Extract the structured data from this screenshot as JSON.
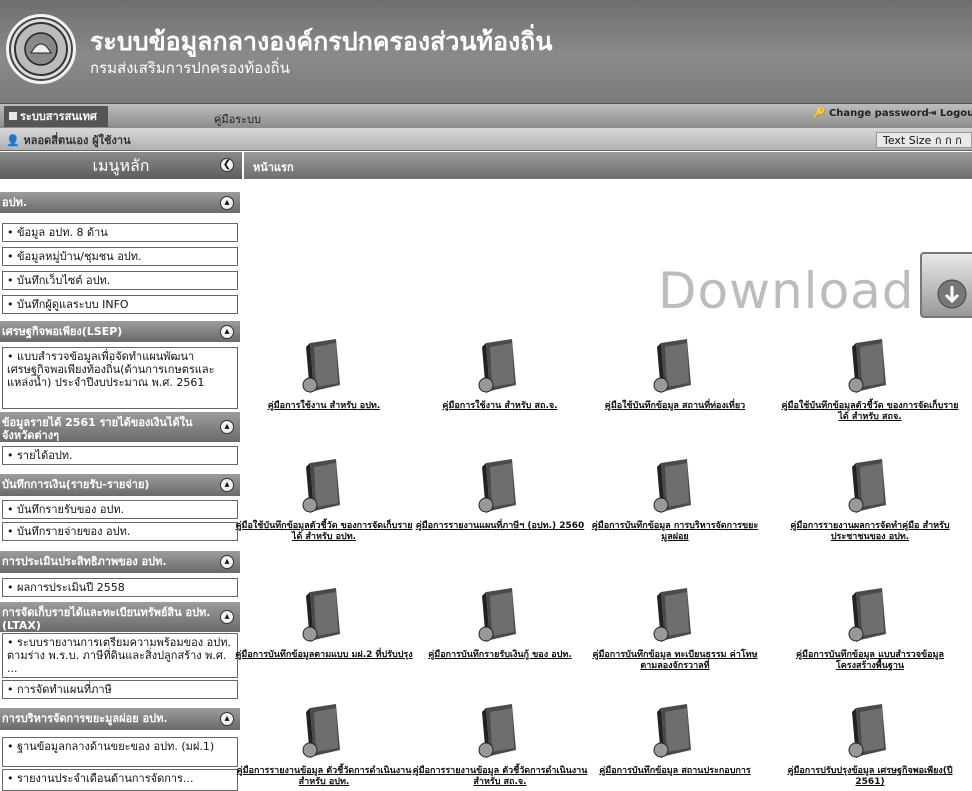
{
  "header": {
    "title": "ระบบข้อมูลกลางองค์กรปกครองส่วนท้องถิ่น",
    "subtitle": "กรมส่งเสริมการปกครองท้องถิ่น",
    "logo_icon": "government-seal"
  },
  "menubar": {
    "home_tab": "ระบบสารสนเทศ",
    "manual_tab": "คู่มือระบบ",
    "change_password": "Change password",
    "logout": "Logout"
  },
  "userbar": {
    "user_label": "หลอดสี่ตนเอง ผู้ใช้งาน",
    "text_size": "Text Size  ก ก ก"
  },
  "sidebar": {
    "title": "เมนูหลัก",
    "breadcrumb": "หน้าแรก",
    "sections": [
      {
        "title": "อปท.",
        "items": [
          "ข้อมูล อปท. 8 ด้าน",
          "ข้อมูลหมู่บ้าน/ชุมชน อปท.",
          "บันทึกเว็บไซต์ อปท.",
          "บันทึกผู้ดูแลระบบ INFO"
        ]
      },
      {
        "title": "เศรษฐกิจพอเพียง(LSEP)",
        "items": [
          "แบบสำรวจข้อมูลเพื่อจัดทำแผนพัฒนาเศรษฐกิจพอเพียงท้องถิ่น(ด้านการเกษตรและแหล่งน้ำ) ประจำปีงบประมาณ พ.ศ. 2561"
        ]
      },
      {
        "title": "ข้อมูลรายได้ 2561 รายได้ของเงินได้ในจังหวัดต่างๆ",
        "items": [
          "รายได้อปท."
        ]
      },
      {
        "title": "บันทึกการเงิน(รายรับ-รายจ่าย)",
        "items": [
          "บันทึกรายรับของ อปท.",
          "บันทึกรายจ่ายของ อปท."
        ]
      },
      {
        "title": "การประเมินประสิทธิภาพของ อปท.",
        "items": [
          "ผลการประเมินปี 2558"
        ]
      },
      {
        "title": "การจัดเก็บรายได้และทะเบียนทรัพย์สิน อปท. (LTAX)",
        "items": [
          "ระบบรายงานการเตรียมความพร้อมของ อปท. ตามร่าง พ.ร.บ. ภาษีที่ดินและสิ่งปลูกสร้าง พ.ศ. ...",
          "การจัดทำแผนที่ภาษี"
        ]
      },
      {
        "title": "การบริหารจัดการขยะมูลฝอย อปท.",
        "items": [
          "ฐานข้อมูลกลางด้านขยะของ อปท. (มฝ.1)",
          "รายงานประจำเดือนด้านการจัดการ..."
        ]
      }
    ]
  },
  "main": {
    "download_text": "Download",
    "documents": [
      "คู่มือการใช้งาน สำหรับ อปท.",
      "คู่มือการใช้งาน สำหรับ สถ.จ.",
      "คู่มือใช้บันทึกข้อมูล สถานที่ท่องเที่ยว",
      "คู่มือใช้บันทึกข้อมูลตัวชี้วัด ของการจัดเก็บรายได้ สำหรับ สถจ.",
      "คู่มือใช้บันทึกข้อมูลตัวชี้วัด ของการจัดเก็บรายได้ สำหรับ อปท.",
      "คู่มือการรายงานแผนที่ภาษีฯ (อปท.) 2560",
      "คู่มือการบันทึกข้อมูล การบริหารจัดการขยะมูลฝอย",
      "คู่มือการรายงานผลการจัดทำคู่มือ สำหรับประชาชนของ อปท.",
      "คู่มือการบันทึกข้อมูลตามแบบ มฝ.2 ที่ปรับปรุง",
      "คู่มือการบันทึกรายรับเงินกู้ ของ อปท.",
      "คู่มือการบันทึกข้อมูล ทะเบียนธรรม ค่าโทษ ตามลองจักรวาลที่",
      "คู่มือการบันทึกข้อมูล แบบสำรวจข้อมูลโครงสร้างพื้นฐาน",
      "คู่มือการรายงานข้อมูล ตัวชี้วัดการดำเนินงานสำหรับ อปท.",
      "คู่มือการรายงานข้อมูล ตัวชี้วัดการดำเนินงาน สำหรับ สถ.จ.",
      "คู่มือการบันทึกข้อมูล สถานประกอบการ",
      "คู่มือการปรับปรุงข้อมูล เศรษฐกิจพอเพียง(ปี 2561)"
    ]
  }
}
